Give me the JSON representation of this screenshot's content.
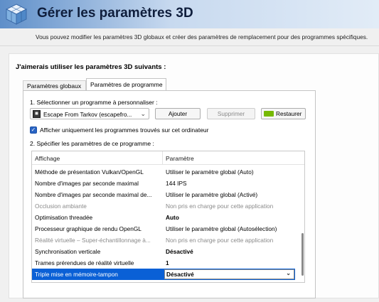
{
  "header": {
    "title": "Gérer les paramètres 3D",
    "description": "Vous pouvez modifier les paramètres 3D globaux et créer des paramètres de remplacement pour des programmes spécifiques."
  },
  "panel": {
    "heading": "J'aimerais utiliser les paramètres 3D suivants :",
    "tabs": [
      {
        "label": "Paramètres globaux",
        "active": false
      },
      {
        "label": "Paramètres de programme",
        "active": true
      }
    ],
    "step1_label": "1. Sélectionner un programme à personnaliser :",
    "program_select": {
      "value": "Escape From Tarkov (escapefro...",
      "icon": "game-icon"
    },
    "buttons": {
      "add": "Ajouter",
      "remove": "Supprimer",
      "restore": "Restaurer"
    },
    "checkbox": {
      "label": "Afficher uniquement les programmes trouvés sur cet ordinateur",
      "checked": true
    },
    "step2_label": "2. Spécifier les paramètres de ce programme :"
  },
  "settings_table": {
    "columns": [
      "Affichage",
      "Paramètre"
    ],
    "rows": [
      {
        "feature": "Méthode de présentation Vulkan/OpenGL",
        "value": "Utiliser le paramètre global (Auto)",
        "disabled": false,
        "bold": false
      },
      {
        "feature": "Nombre d'images par seconde maximal",
        "value": "144 IPS",
        "disabled": false,
        "bold": false
      },
      {
        "feature": "Nombre d'images par seconde maximal de...",
        "value": "Utiliser le paramètre global (Activé)",
        "disabled": false,
        "bold": false
      },
      {
        "feature": "Occlusion ambiante",
        "value": "Non pris en charge pour cette application",
        "disabled": true,
        "bold": false
      },
      {
        "feature": "Optimisation threadée",
        "value": "Auto",
        "disabled": false,
        "bold": true
      },
      {
        "feature": "Processeur graphique de rendu OpenGL",
        "value": "Utiliser le paramètre global (Autosélection)",
        "disabled": false,
        "bold": false
      },
      {
        "feature": "Réalité virtuelle – Super-échantillonnage à...",
        "value": "Non pris en charge pour cette application",
        "disabled": true,
        "bold": false
      },
      {
        "feature": "Synchronisation verticale",
        "value": "Désactivé",
        "disabled": false,
        "bold": true
      },
      {
        "feature": "Trames prérendues de réalité virtuelle",
        "value": "1",
        "disabled": false,
        "bold": true
      },
      {
        "feature": "Triple mise en mémoire-tampon",
        "value": "Désactivé",
        "disabled": false,
        "bold": true,
        "selected": true
      }
    ]
  },
  "colors": {
    "selection": "#0a60d6",
    "nvidia_green": "#76b900",
    "checkbox": "#2964c4"
  }
}
